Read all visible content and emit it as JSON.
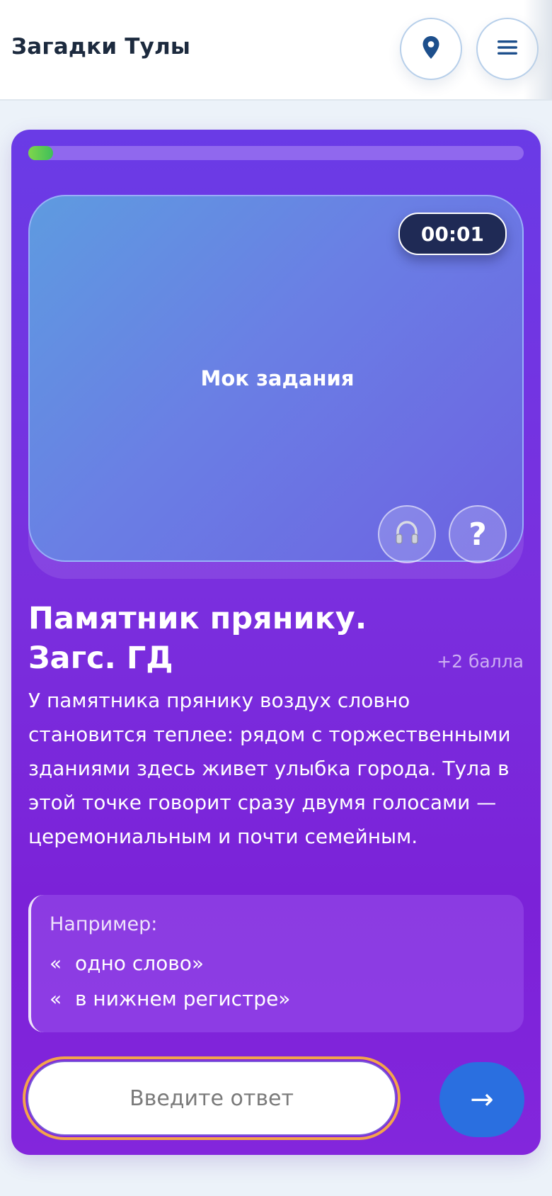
{
  "header": {
    "title": "Загадки Тулы",
    "location_icon": "map-pin-icon",
    "menu_icon": "hamburger-menu-icon"
  },
  "progress": {
    "fraction": 0.05
  },
  "task": {
    "timer": "00:01",
    "media_label": "Мок задания",
    "audio_icon": "headphones-icon",
    "help_label": "?",
    "title": "Памятник прянику. Загс. ГД",
    "points": "+2 балла",
    "description": "У памятника прянику воздух словно становится теплее: рядом с торжественными зданиями здесь живет улыбка города. Тула в этой точке говорит сразу двумя голосами — церемониальным и почти семейным."
  },
  "example": {
    "title": "Например:",
    "items": [
      {
        "quote": "«",
        "text": "одно слово»"
      },
      {
        "quote": "«",
        "text": "в нижнем регистре»"
      }
    ]
  },
  "answer": {
    "placeholder": "Введите ответ",
    "submit_icon": "→"
  },
  "colors": {
    "card_top": "#6a3be6",
    "card_bottom": "#8326dc",
    "progress": "#7fd64b",
    "input_ring": "#f3a44b",
    "submit": "#2a6fe0",
    "timer_bg": "#1f2a55"
  }
}
